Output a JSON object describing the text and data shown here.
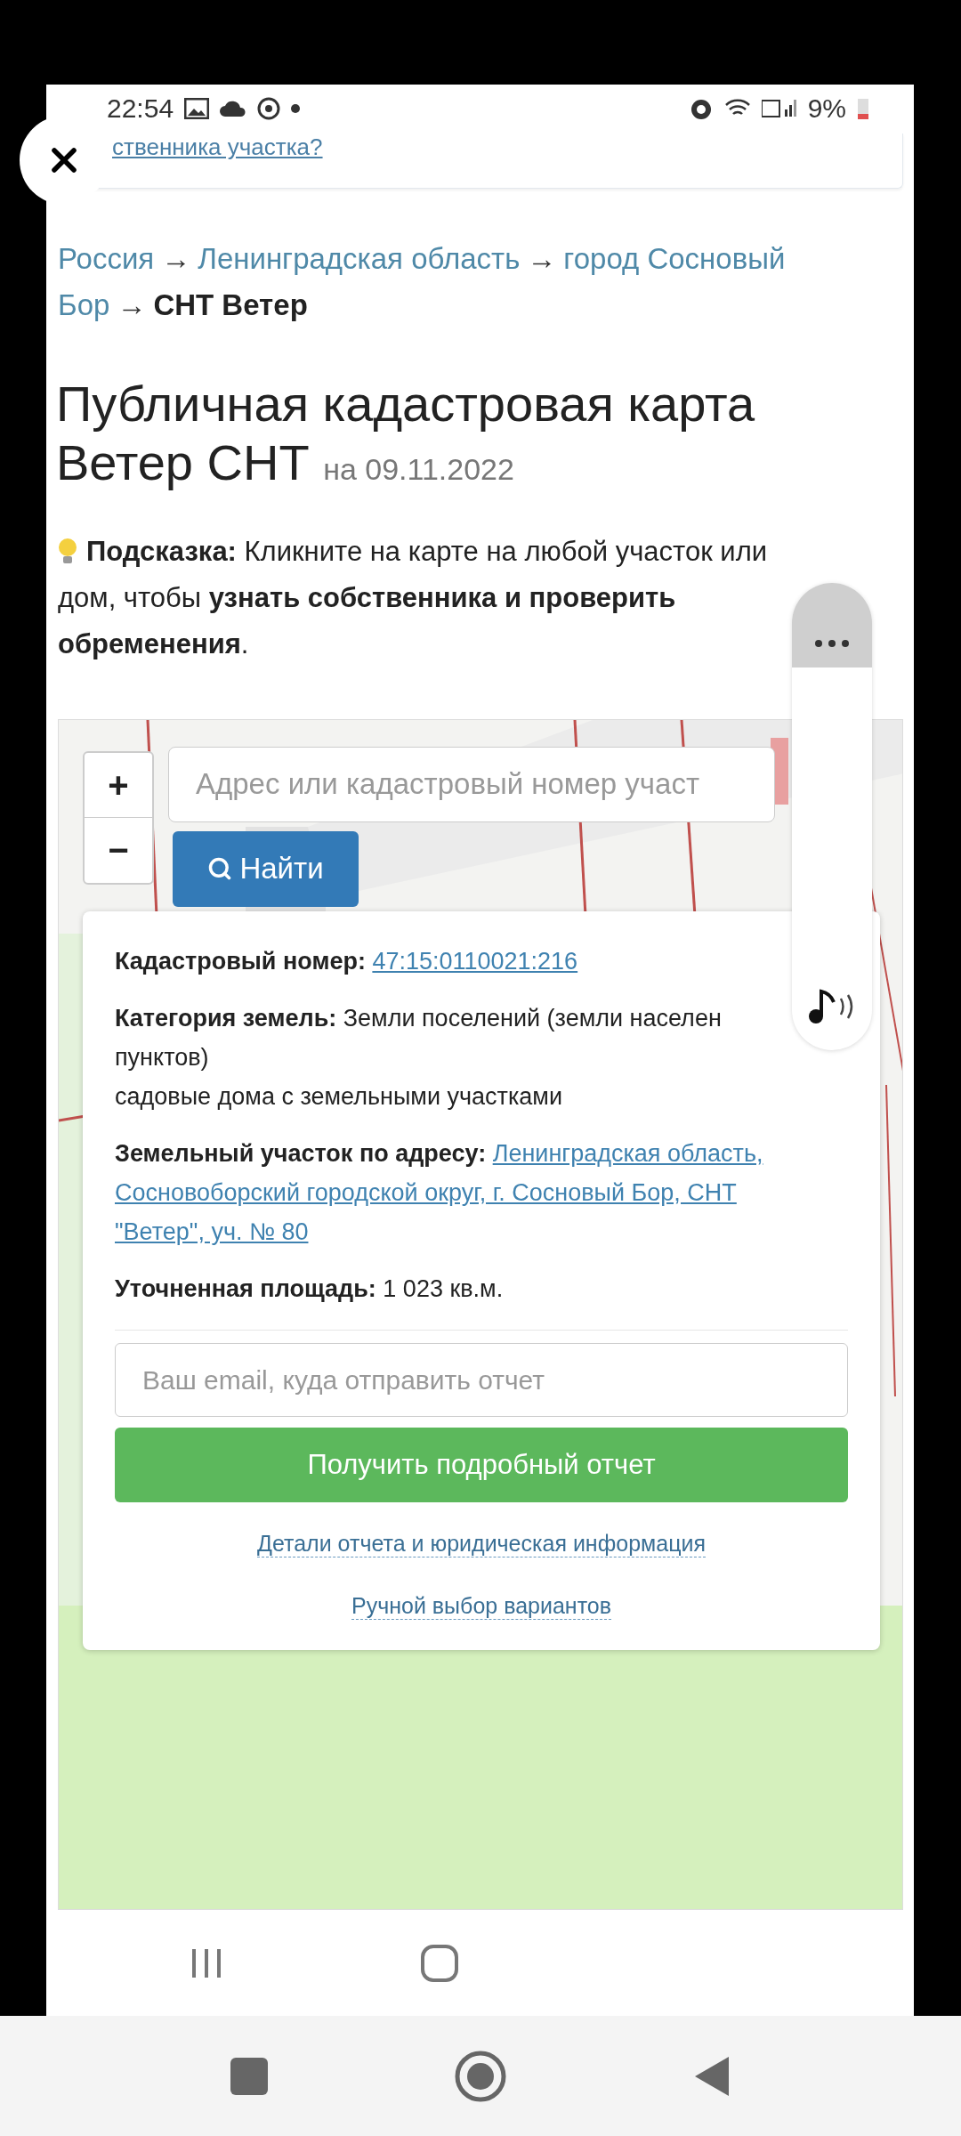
{
  "status_bar": {
    "time": "22:54",
    "battery": "9%"
  },
  "top_card": {
    "link": "ственника участка?"
  },
  "breadcrumbs": [
    {
      "lines": [
        "Россия"
      ],
      "kind": "link"
    },
    {
      "lines": [
        "Ленинградская область"
      ],
      "kind": "link"
    },
    {
      "lines": [
        "город Сосновый",
        "Бор"
      ],
      "kind": "link"
    },
    {
      "lines": [
        "СНТ Ветер"
      ],
      "kind": "current"
    }
  ],
  "breadcrumb_separator": "→",
  "title": "Публичная кадастровая карта Ветер СНТ",
  "title_date": "на 09.11.2022",
  "hint": [
    "**Подсказка:** Кликните на карте на любой участок или",
    "дом, чтобы **узнать собственника и проверить**",
    "**обременения**."
  ],
  "map": {
    "zoom_in": "+",
    "zoom_out": "−",
    "search_placeholder": "Адрес или кадастровый номер участ",
    "search_button": "Найти"
  },
  "popup": {
    "rows": [
      {
        "label": "Кадастровый номер:",
        "kind": "link",
        "lines": [
          "47:15:0110021:216"
        ]
      },
      {
        "label": "Категория земель:",
        "kind": "text",
        "lines": [
          "Земли поселений (земли населен",
          "пунктов)",
          "садовые дома с земельными участками"
        ]
      },
      {
        "label": "Земельный участок по адресу:",
        "kind": "link",
        "lines": [
          "Ленинградская область,",
          "Сосновоборский городской округ, г. Сосновый Бор, СНТ",
          "\"Ветер\", уч. № 80"
        ]
      },
      {
        "label": "Уточненная площадь:",
        "kind": "text",
        "lines": [
          "1 023 кв.м."
        ]
      }
    ],
    "email_placeholder": "Ваш email, куда отправить отчет",
    "report_button": "Получить подробный отчет",
    "links": [
      "Детали отчета и юридическая информация",
      "Ручной выбор вариантов"
    ]
  }
}
